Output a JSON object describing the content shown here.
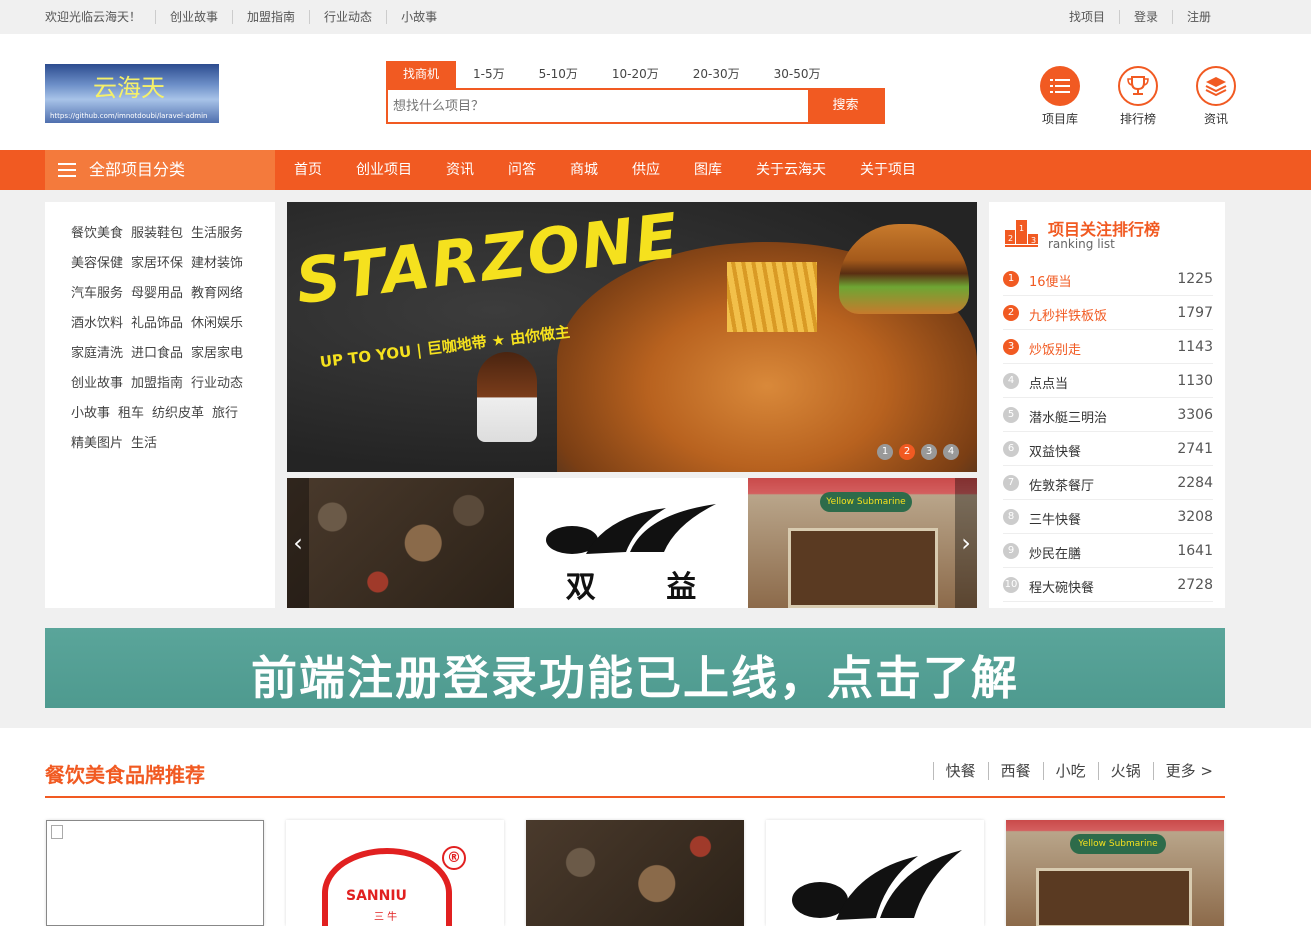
{
  "topbar": {
    "left": [
      "欢迎光临云海天！",
      "创业故事",
      "加盟指南",
      "行业动态",
      "小故事"
    ],
    "right": [
      "找项目",
      "登录",
      "注册"
    ]
  },
  "logo": {
    "title": "云海天",
    "sub": "https://github.com/imnotdoubi/laravel-admin"
  },
  "search": {
    "tabs": [
      "找商机",
      "1-5万",
      "5-10万",
      "10-20万",
      "20-30万",
      "30-50万"
    ],
    "placeholder": "想找什么项目？",
    "button": "搜索"
  },
  "quicklinks": [
    {
      "label": "项目库",
      "icon": "list-icon"
    },
    {
      "label": "排行榜",
      "icon": "trophy-icon"
    },
    {
      "label": "资讯",
      "icon": "layers-icon"
    }
  ],
  "nav": {
    "all": "全部项目分类",
    "items": [
      "首页",
      "创业项目",
      "资讯",
      "问答",
      "商城",
      "供应",
      "图库",
      "关于云海天",
      "关于项目"
    ]
  },
  "categories": [
    "餐饮美食",
    "服装鞋包",
    "生活服务",
    "美容保健",
    "家居环保",
    "建材装饰",
    "汽车服务",
    "母婴用品",
    "教育网络",
    "酒水饮料",
    "礼品饰品",
    "休闲娱乐",
    "家庭清洗",
    "进口食品",
    "家居家电",
    "创业故事",
    "加盟指南",
    "行业动态",
    "小故事",
    "租车",
    "纺织皮革",
    "旅行",
    "精美图片",
    "生活"
  ],
  "banner": {
    "brand": "STARZONE",
    "slogan": "UP TO YOU | 巨咖地带 ★ 由你做主",
    "dots": [
      "1",
      "2",
      "3",
      "4"
    ],
    "active_dot": 1
  },
  "thumbs": {
    "shuangyi": "双 益",
    "submarine": "Yellow Submarine"
  },
  "ranking": {
    "title": "项目关注排行榜",
    "subtitle": "ranking list",
    "items": [
      {
        "rank": "1",
        "name": "16便当",
        "count": "1225"
      },
      {
        "rank": "2",
        "name": "九秒拌铁板饭",
        "count": "1797"
      },
      {
        "rank": "3",
        "name": "炒饭别走",
        "count": "1143"
      },
      {
        "rank": "4",
        "name": "点点当",
        "count": "1130"
      },
      {
        "rank": "5",
        "name": "潜水艇三明治",
        "count": "3306"
      },
      {
        "rank": "6",
        "name": "双益快餐",
        "count": "2741"
      },
      {
        "rank": "7",
        "name": "佐敦茶餐厅",
        "count": "2284"
      },
      {
        "rank": "8",
        "name": "三牛快餐",
        "count": "3208"
      },
      {
        "rank": "9",
        "name": "炒民在膳",
        "count": "1641"
      },
      {
        "rank": "10",
        "name": "程大碗快餐",
        "count": "2728"
      }
    ]
  },
  "promo": {
    "text": "前端注册登录功能已上线，点击了解"
  },
  "section": {
    "title": "餐饮美食品牌推荐",
    "links": [
      "快餐",
      "西餐",
      "小吃",
      "火锅",
      "更多 >"
    ]
  },
  "cards": {
    "sanniu_en": "SANNIU",
    "sanniu_zh": "三 牛",
    "reg": "®",
    "submarine": "Yellow Submarine"
  },
  "colors": {
    "brand": "#f15a22",
    "nav_dark": "#f47a3c",
    "promo": "#5aa59a",
    "gray": "#f0f0f0"
  }
}
